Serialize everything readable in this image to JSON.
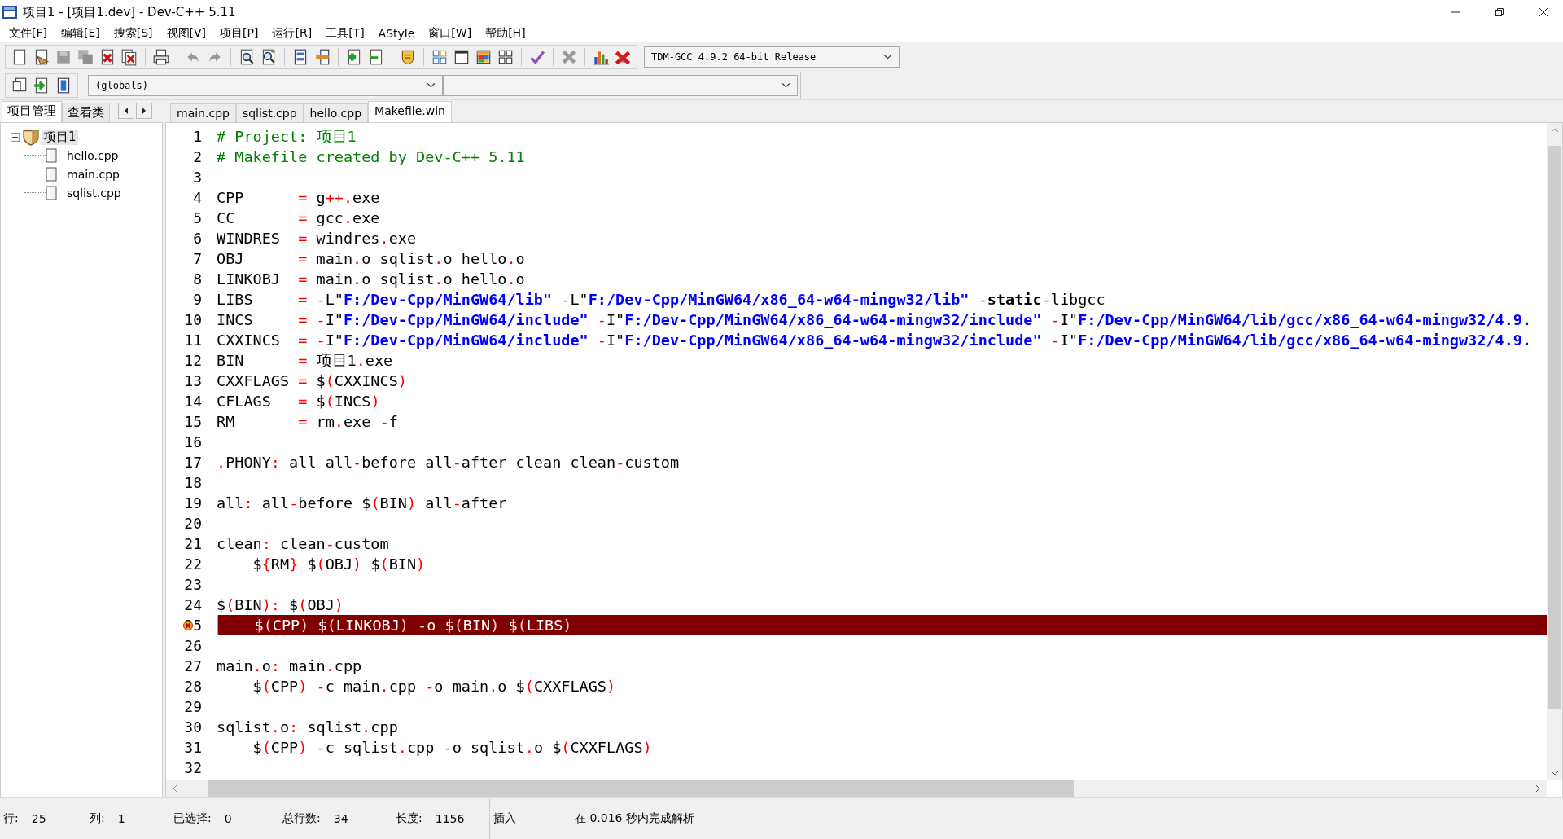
{
  "window": {
    "title": "项目1 - [项目1.dev] - Dev-C++ 5.11"
  },
  "menu": [
    "文件[F]",
    "编辑[E]",
    "搜索[S]",
    "视图[V]",
    "项目[P]",
    "运行[R]",
    "工具[T]",
    "AStyle",
    "窗口[W]",
    "帮助[H]"
  ],
  "toolbar": {
    "compiler": "TDM-GCC 4.9.2 64-bit Release",
    "scope": "(globals)"
  },
  "side_tabs": [
    {
      "label": "项目管理",
      "selected": true
    },
    {
      "label": "查看类",
      "selected": false
    }
  ],
  "project_tree": [
    {
      "label": "项目1",
      "expanded": true,
      "selected": true,
      "children": [
        {
          "label": "hello.cpp",
          "selected": false
        },
        {
          "label": "main.cpp",
          "selected": false
        },
        {
          "label": "sqlist.cpp",
          "selected": false
        }
      ]
    }
  ],
  "file_tabs": [
    {
      "label": "main.cpp",
      "selected": false
    },
    {
      "label": "sqlist.cpp",
      "selected": false
    },
    {
      "label": "hello.cpp",
      "selected": false
    },
    {
      "label": "Makefile.win",
      "selected": true
    }
  ],
  "editor": {
    "lines": [
      {
        "number": "1",
        "error": false,
        "segments": [
          {
            "kind": "comment",
            "text": "# Project: 项目1"
          }
        ]
      },
      {
        "number": "2",
        "error": false,
        "segments": [
          {
            "kind": "comment",
            "text": "# Makefile created by Dev-C++ 5.11"
          }
        ]
      },
      {
        "number": "3",
        "error": false
      },
      {
        "number": "4",
        "error": false,
        "segments": [
          {
            "kind": "text",
            "text": "CPP      = g++.exe"
          }
        ]
      },
      {
        "number": "5",
        "error": false,
        "segments": [
          {
            "kind": "text",
            "text": "CC       = gcc.exe"
          }
        ]
      },
      {
        "number": "6",
        "error": false,
        "segments": [
          {
            "kind": "text",
            "text": "WINDRES  = windres.exe"
          }
        ]
      },
      {
        "number": "7",
        "error": false,
        "segments": [
          {
            "kind": "text",
            "text": "OBJ      = main.o sqlist.o hello.o"
          }
        ]
      },
      {
        "number": "8",
        "error": false,
        "segments": [
          {
            "kind": "text",
            "text": "LINKOBJ  = main.o sqlist.o hello.o"
          }
        ]
      },
      {
        "number": "9",
        "error": false,
        "segments": [
          {
            "kind": "text",
            "text": "LIBS     = -L\""
          },
          {
            "kind": "string",
            "text": "F:/Dev-Cpp/MinGW64/lib\""
          },
          {
            "kind": "text",
            "text": " -L\""
          },
          {
            "kind": "string",
            "text": "F:/Dev-Cpp/MinGW64/x86_64-w64-mingw32/lib\""
          },
          {
            "kind": "text",
            "text": " -"
          },
          {
            "kind": "keyword",
            "text": "static"
          },
          {
            "kind": "text",
            "text": "-libgcc"
          }
        ]
      },
      {
        "number": "10",
        "error": false,
        "segments": [
          {
            "kind": "text",
            "text": "INCS     = -I\""
          },
          {
            "kind": "string",
            "text": "F:/Dev-Cpp/MinGW64/include\""
          },
          {
            "kind": "text",
            "text": " -I\""
          },
          {
            "kind": "string",
            "text": "F:/Dev-Cpp/MinGW64/x86_64-w64-mingw32/include\""
          },
          {
            "kind": "text",
            "text": " -I\""
          },
          {
            "kind": "string",
            "text": "F:/Dev-Cpp/MinGW64/lib/gcc/x86_64-w64-mingw32/4.9."
          }
        ]
      },
      {
        "number": "11",
        "error": false,
        "segments": [
          {
            "kind": "text",
            "text": "CXXINCS  = -I\""
          },
          {
            "kind": "string",
            "text": "F:/Dev-Cpp/MinGW64/include\""
          },
          {
            "kind": "text",
            "text": " -I\""
          },
          {
            "kind": "string",
            "text": "F:/Dev-Cpp/MinGW64/x86_64-w64-mingw32/include\""
          },
          {
            "kind": "text",
            "text": " -I\""
          },
          {
            "kind": "string",
            "text": "F:/Dev-Cpp/MinGW64/lib/gcc/x86_64-w64-mingw32/4.9."
          }
        ]
      },
      {
        "number": "12",
        "error": false,
        "segments": [
          {
            "kind": "text",
            "text": "BIN      = 项目1.exe"
          }
        ]
      },
      {
        "number": "13",
        "error": false,
        "segments": [
          {
            "kind": "text",
            "text": "CXXFLAGS = $(CXXINCS)"
          }
        ]
      },
      {
        "number": "14",
        "error": false,
        "segments": [
          {
            "kind": "text",
            "text": "CFLAGS   = $(INCS)"
          }
        ]
      },
      {
        "number": "15",
        "error": false,
        "segments": [
          {
            "kind": "text",
            "text": "RM       = rm.exe -f"
          }
        ]
      },
      {
        "number": "16",
        "error": false
      },
      {
        "number": "17",
        "error": false,
        "segments": [
          {
            "kind": "text",
            "text": ".PHONY: all all-before all-after clean clean-custom"
          }
        ]
      },
      {
        "number": "18",
        "error": false
      },
      {
        "number": "19",
        "error": false,
        "segments": [
          {
            "kind": "text",
            "text": "all: all-before $(BIN) all-after"
          }
        ]
      },
      {
        "number": "20",
        "error": false
      },
      {
        "number": "21",
        "error": false,
        "segments": [
          {
            "kind": "text",
            "text": "clean: clean-custom"
          }
        ]
      },
      {
        "number": "22",
        "error": false,
        "segments": [
          {
            "kind": "text",
            "text": "    ${RM} $(OBJ) $(BIN)"
          }
        ]
      },
      {
        "number": "23",
        "error": false
      },
      {
        "number": "24",
        "error": false,
        "segments": [
          {
            "kind": "text",
            "text": "$(BIN): $(OBJ)"
          }
        ]
      },
      {
        "number": "25",
        "error": true,
        "segments": [
          {
            "kind": "text",
            "text": "    $(CPP) $(LINKOBJ) -o $(BIN) $(LIBS)"
          }
        ]
      },
      {
        "number": "26",
        "error": false
      },
      {
        "number": "27",
        "error": false,
        "segments": [
          {
            "kind": "text",
            "text": "main.o: main.cpp"
          }
        ]
      },
      {
        "number": "28",
        "error": false,
        "segments": [
          {
            "kind": "text",
            "text": "    $(CPP) -c main.cpp -o main.o $(CXXFLAGS)"
          }
        ]
      },
      {
        "number": "29",
        "error": false
      },
      {
        "number": "30",
        "error": false,
        "segments": [
          {
            "kind": "text",
            "text": "sqlist.o: sqlist.cpp"
          }
        ]
      },
      {
        "number": "31",
        "error": false,
        "segments": [
          {
            "kind": "text",
            "text": "    $(CPP) -c sqlist.cpp -o sqlist.o $(CXXFLAGS)"
          }
        ]
      },
      {
        "number": "32",
        "error": false
      }
    ]
  },
  "status_bar": [
    {
      "label": "行:",
      "value": "25"
    },
    {
      "label": "列:",
      "value": "1"
    },
    {
      "label": "已选择:",
      "value": "0"
    },
    {
      "label": "总行数:",
      "value": "34"
    },
    {
      "label": "长度:",
      "value": "1156"
    },
    {
      "value": "插入"
    },
    {
      "value": "在 0.016 秒内完成解析"
    }
  ]
}
